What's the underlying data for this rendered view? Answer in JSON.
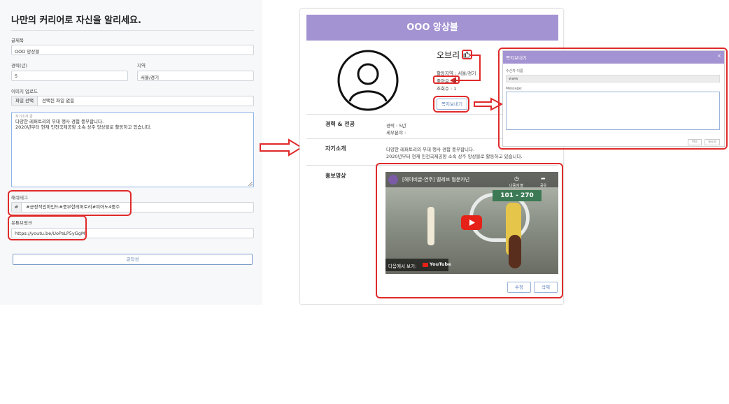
{
  "form": {
    "title": "나만의 커리어로 자신을 알리세요.",
    "fields": {
      "title_label": "글제목",
      "title_value": "OOO 앙상블",
      "career_label": "경력(년)",
      "career_value": "5",
      "region_label": "지역",
      "region_value": "서울/경기",
      "image_label": "이미지 업로드",
      "file_button": "파일 선택",
      "file_status": "선택된 파일 없음",
      "intro_placeholder": "자기소개 글",
      "intro_line1": "다양한 레퍼토리의 무대 행사 경험 풍부합니다.",
      "intro_line2": "2020년부터 현재 인천국제공항 소속 상주 앙상블로 활동하고 있습니다.",
      "hashtag_label": "해쉬태그",
      "hashtag_prefix": "#",
      "hashtag_value": "#긍정적인마인드#풍부한레퍼토리#피아노4중주",
      "youtube_label": "유튜브링크",
      "youtube_value": "https://youtu.be/UoPsLP5yGgM"
    },
    "submit_label": "글작성"
  },
  "profile": {
    "banner": "OOO 앙상블",
    "name": "오브리",
    "like_icon": "thumbs-up-icon",
    "region": "활동지역 : 서울/경기",
    "likes": "좋아요 : 0",
    "views": "조회수 : 1",
    "message_button": "쪽지보내기",
    "career_heading": "경력 & 전공",
    "career_line1": "경력 : 5년",
    "career_line2": "세부분야 :",
    "intro_heading": "자기소개",
    "intro_line1": "다양한 레퍼토리의 무대 행사 경험 풍부합니다.",
    "intro_line2": "2020년부터 현재 인천국제공항 소속 상주 앙상블로 활동하고 있습니다.",
    "video_heading": "홍보영상",
    "video_title": "[헤이비글-연주] 벨레브 협문카넌",
    "video_next": "다음에서 보기:",
    "video_brand": "YouTube",
    "video_sign": "101 - 270",
    "video_later": "나중에 볼",
    "video_share": "공유",
    "edit_button": "수정",
    "delete_button": "삭제"
  },
  "modal": {
    "title": "쪽지보내기",
    "close": "×",
    "recipient_label": "수신자 이름",
    "recipient_value": "www",
    "message_label": "Message:",
    "cancel_button": "취소",
    "send_button": "Send"
  },
  "colors": {
    "accent": "#a393d2",
    "highlight": "#e02a2a",
    "panel_bg": "#f7f8fa"
  }
}
